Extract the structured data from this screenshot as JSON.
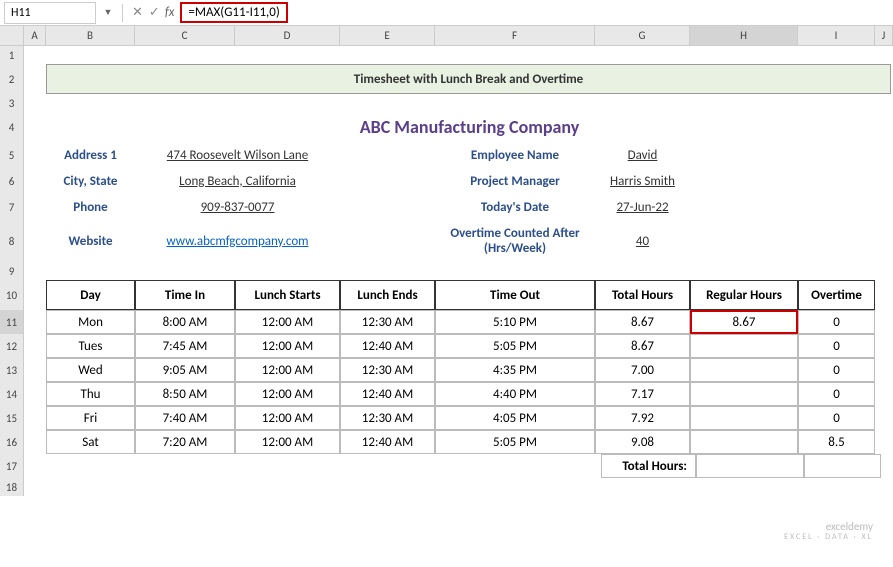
{
  "toolbar": {
    "cell_ref": "H11",
    "formula": "=MAX(G11-I11,0)"
  },
  "columns": [
    "A",
    "B",
    "C",
    "D",
    "E",
    "F",
    "G",
    "H",
    "I",
    "J"
  ],
  "rows": [
    "1",
    "2",
    "3",
    "4",
    "5",
    "6",
    "7",
    "8",
    "9",
    "10",
    "11",
    "12",
    "13",
    "14",
    "15",
    "16",
    "17",
    "18"
  ],
  "banner": "Timesheet with Lunch Break and Overtime",
  "company": "ABC Manufacturing Company",
  "info_left": {
    "address_label": "Address 1",
    "address_val": "474 Roosevelt Wilson Lane",
    "city_label": "City, State",
    "city_val": "Long Beach, California",
    "phone_label": "Phone",
    "phone_val": "909-837-0077",
    "website_label": "Website",
    "website_val": "www.abcmfgcompany.com"
  },
  "info_right": {
    "emp_label": "Employee Name",
    "emp_val": "David",
    "pm_label": "Project Manager",
    "pm_val": "Harris Smith",
    "date_label": "Today's Date",
    "date_val": "27-Jun-22",
    "ot_label": "Overtime Counted After (Hrs/Week)",
    "ot_val": "40"
  },
  "table": {
    "headers": [
      "Day",
      "Time In",
      "Lunch Starts",
      "Lunch Ends",
      "Time Out",
      "Total Hours",
      "Regular Hours",
      "Overtime"
    ],
    "rows": [
      {
        "day": "Mon",
        "in": "8:00 AM",
        "ls": "12:00 AM",
        "le": "12:30 AM",
        "out": "5:10 PM",
        "total": "8.67",
        "reg": "8.67",
        "ot": "0"
      },
      {
        "day": "Tues",
        "in": "7:45 AM",
        "ls": "12:00 AM",
        "le": "12:40 AM",
        "out": "5:05 PM",
        "total": "8.67",
        "reg": "",
        "ot": "0"
      },
      {
        "day": "Wed",
        "in": "9:05 AM",
        "ls": "12:00 AM",
        "le": "12:30 AM",
        "out": "4:35 PM",
        "total": "7.00",
        "reg": "",
        "ot": "0"
      },
      {
        "day": "Thu",
        "in": "8:50 AM",
        "ls": "12:00 AM",
        "le": "12:40 AM",
        "out": "4:40 PM",
        "total": "7.17",
        "reg": "",
        "ot": "0"
      },
      {
        "day": "Fri",
        "in": "7:40 AM",
        "ls": "12:00 AM",
        "le": "12:30 AM",
        "out": "4:05 PM",
        "total": "7.92",
        "reg": "",
        "ot": "0"
      },
      {
        "day": "Sat",
        "in": "7:20 AM",
        "ls": "12:00 AM",
        "le": "12:40 AM",
        "out": "5:05 PM",
        "total": "9.08",
        "reg": "",
        "ot": "8.5"
      }
    ],
    "footer_label": "Total Hours:"
  },
  "watermark": {
    "main": "exceldemy",
    "sub": "EXCEL · DATA · XL"
  }
}
